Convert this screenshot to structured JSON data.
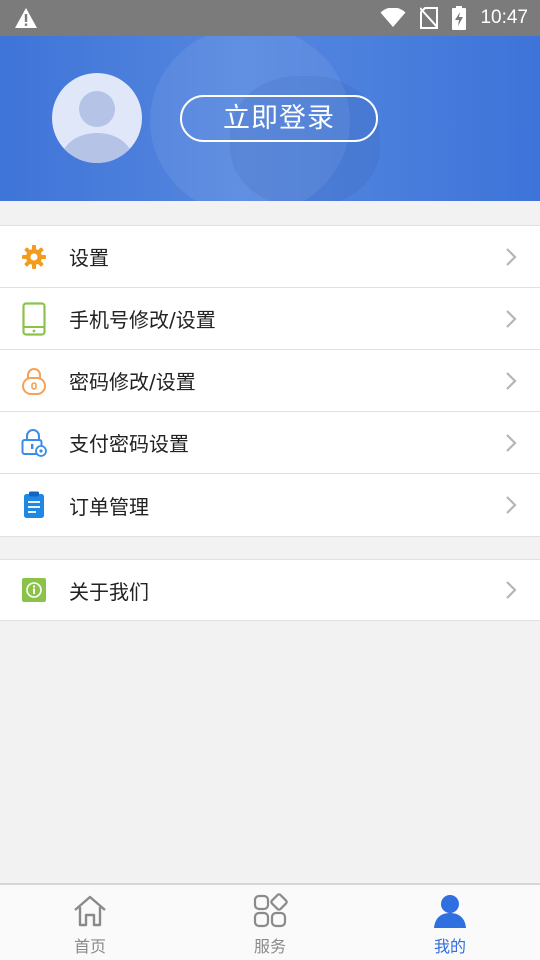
{
  "status_bar": {
    "time": "10:47"
  },
  "header": {
    "login_label": "立即登录"
  },
  "menu_group_1": [
    {
      "label": "设置",
      "icon": "gear-icon",
      "color": "#f29b1d"
    },
    {
      "label": "手机号修改/设置",
      "icon": "phone-icon",
      "color": "#8bc34a"
    },
    {
      "label": "密码修改/设置",
      "icon": "lock-icon",
      "color": "#f7a05a"
    },
    {
      "label": "支付密码设置",
      "icon": "pay-lock-icon",
      "color": "#3b8de6"
    },
    {
      "label": "订单管理",
      "icon": "clipboard-icon",
      "color": "#1e88e5"
    }
  ],
  "menu_group_2": [
    {
      "label": "关于我们",
      "icon": "info-icon",
      "color": "#8bc34a"
    }
  ],
  "bottom_nav": [
    {
      "label": "首页",
      "icon": "home-icon",
      "active": false
    },
    {
      "label": "服务",
      "icon": "grid-icon",
      "active": false
    },
    {
      "label": "我的",
      "icon": "user-icon",
      "active": true
    }
  ],
  "colors": {
    "header": "#4a7fdc",
    "accent": "#2f6fe0",
    "background": "#f2f2f2"
  }
}
